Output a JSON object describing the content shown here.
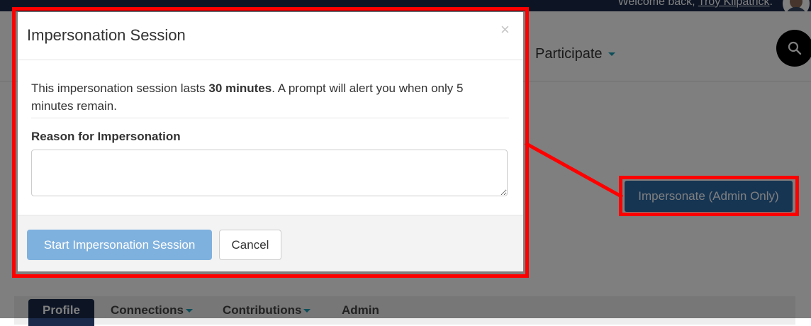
{
  "header": {
    "welcome_prefix": "Welcome back, ",
    "user_name": "Troy Kilpatrick",
    "welcome_suffix": "."
  },
  "nav": {
    "participate_label": "Participate",
    "search_icon": "search-icon"
  },
  "page": {
    "impersonate_button_label": "Impersonate (Admin Only)",
    "tabs": [
      {
        "label": "Profile",
        "active": true
      },
      {
        "label": "Connections",
        "has_dropdown": true
      },
      {
        "label": "Contributions",
        "has_dropdown": true
      },
      {
        "label": "Admin"
      }
    ]
  },
  "modal": {
    "title": "Impersonation Session",
    "close_label": "×",
    "message_prefix": "This impersonation session lasts ",
    "message_bold": "30 minutes",
    "message_suffix": ". A prompt will alert you when only 5 minutes remain.",
    "reason_label": "Reason for Impersonation",
    "reason_value": "",
    "start_button_label": "Start Impersonation Session",
    "cancel_button_label": "Cancel"
  },
  "colors": {
    "annotation": "#ff0000",
    "navy": "#1b2a4a",
    "primary_button": "#2d6aa6",
    "start_button_disabled": "#7fb1de",
    "caret_accent": "#1a9cb5"
  }
}
